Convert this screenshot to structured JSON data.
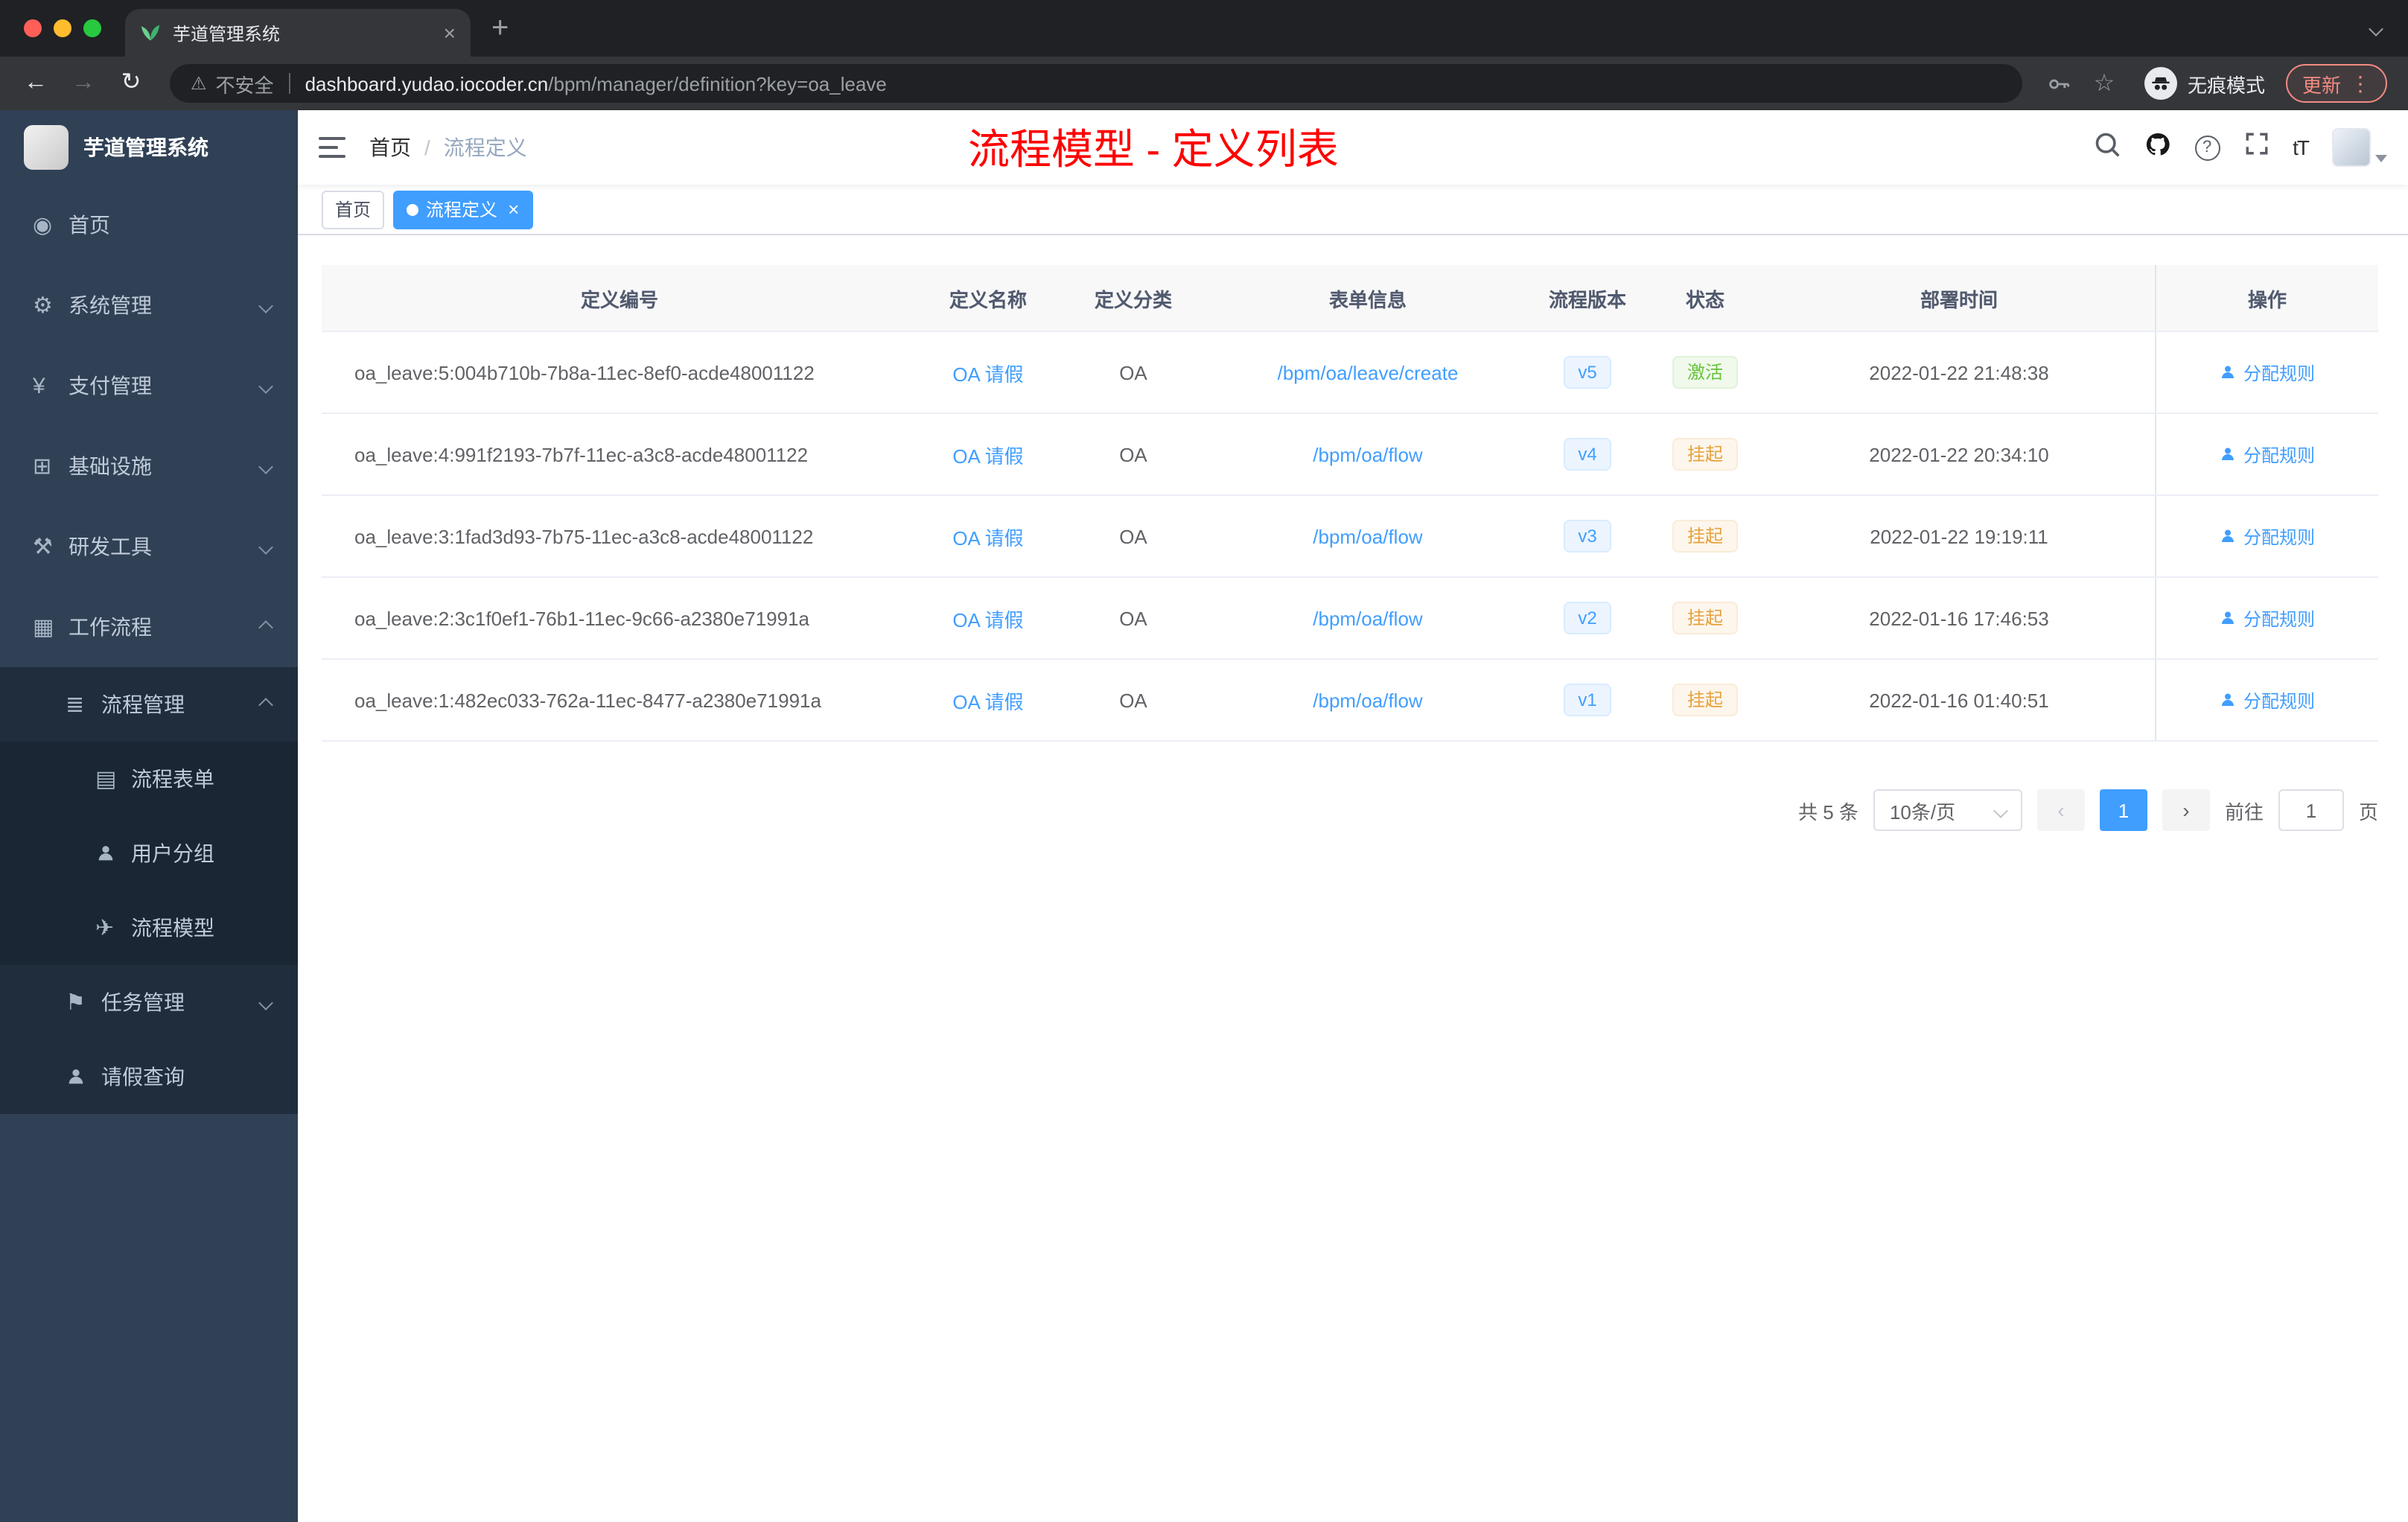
{
  "browser": {
    "tab_title": "芋道管理系统",
    "new_tab_label": "+",
    "security_label": "不安全",
    "url_host": "dashboard.yudao.iocoder.cn",
    "url_path": "/bpm/manager/definition?key=oa_leave",
    "incognito_label": "无痕模式",
    "update_label": "更新"
  },
  "sidebar": {
    "app_title": "芋道管理系统",
    "items": [
      {
        "key": "home",
        "label": "首页",
        "icon": "◉",
        "level": 0,
        "chevron": null
      },
      {
        "key": "system",
        "label": "系统管理",
        "icon": "⚙",
        "level": 0,
        "chevron": "down"
      },
      {
        "key": "payment",
        "label": "支付管理",
        "icon": "¥",
        "level": 0,
        "chevron": "down"
      },
      {
        "key": "infrastructure",
        "label": "基础设施",
        "icon": "⊞",
        "level": 0,
        "chevron": "down"
      },
      {
        "key": "dev-tools",
        "label": "研发工具",
        "icon": "⚒",
        "level": 0,
        "chevron": "down"
      },
      {
        "key": "workflow",
        "label": "工作流程",
        "icon": "▦",
        "level": 0,
        "chevron": "up"
      },
      {
        "key": "process-management",
        "label": "流程管理",
        "icon": "≣",
        "level": 1,
        "chevron": "up"
      },
      {
        "key": "process-form",
        "label": "流程表单",
        "icon": "▤",
        "level": 2,
        "chevron": null
      },
      {
        "key": "user-group",
        "label": "用户分组",
        "icon": "person",
        "level": 2,
        "chevron": null
      },
      {
        "key": "process-model",
        "label": "流程模型",
        "icon": "✈",
        "level": 2,
        "chevron": null
      },
      {
        "key": "task-management",
        "label": "任务管理",
        "icon": "⚑",
        "level": 1,
        "chevron": "down"
      },
      {
        "key": "leave-query",
        "label": "请假查询",
        "icon": "person",
        "level": 1,
        "chevron": null
      }
    ]
  },
  "navbar": {
    "breadcrumb_home": "首页",
    "breadcrumb_separator": "/",
    "breadcrumb_current": "流程定义",
    "annotation": "流程模型 - 定义列表",
    "fontsize_icon_label": "tT"
  },
  "tags": {
    "items": [
      {
        "label": "首页",
        "active": false
      },
      {
        "label": "流程定义",
        "active": true
      }
    ]
  },
  "table": {
    "columns": [
      "定义编号",
      "定义名称",
      "定义分类",
      "表单信息",
      "流程版本",
      "状态",
      "部署时间",
      "操作"
    ],
    "rows": [
      {
        "id": "oa_leave:5:004b710b-7b8a-11ec-8ef0-acde48001122",
        "name": "OA 请假",
        "category": "OA",
        "form": "/bpm/oa/leave/create",
        "version": "v5",
        "status": "激活",
        "status_type": "success",
        "deploy_time": "2022-01-22 21:48:38",
        "action": "分配规则"
      },
      {
        "id": "oa_leave:4:991f2193-7b7f-11ec-a3c8-acde48001122",
        "name": "OA 请假",
        "category": "OA",
        "form": "/bpm/oa/flow",
        "version": "v4",
        "status": "挂起",
        "status_type": "warning",
        "deploy_time": "2022-01-22 20:34:10",
        "action": "分配规则"
      },
      {
        "id": "oa_leave:3:1fad3d93-7b75-11ec-a3c8-acde48001122",
        "name": "OA 请假",
        "category": "OA",
        "form": "/bpm/oa/flow",
        "version": "v3",
        "status": "挂起",
        "status_type": "warning",
        "deploy_time": "2022-01-22 19:19:11",
        "action": "分配规则"
      },
      {
        "id": "oa_leave:2:3c1f0ef1-76b1-11ec-9c66-a2380e71991a",
        "name": "OA 请假",
        "category": "OA",
        "form": "/bpm/oa/flow",
        "version": "v2",
        "status": "挂起",
        "status_type": "warning",
        "deploy_time": "2022-01-16 17:46:53",
        "action": "分配规则"
      },
      {
        "id": "oa_leave:1:482ec033-762a-11ec-8477-a2380e71991a",
        "name": "OA 请假",
        "category": "OA",
        "form": "/bpm/oa/flow",
        "version": "v1",
        "status": "挂起",
        "status_type": "warning",
        "deploy_time": "2022-01-16 01:40:51",
        "action": "分配规则"
      }
    ]
  },
  "pagination": {
    "total": "共 5 条",
    "page_size": "10条/页",
    "prev": "‹",
    "next": "›",
    "current_page": "1",
    "goto_prefix": "前往",
    "goto_value": "1",
    "goto_suffix": "页"
  },
  "colors": {
    "accent_blue": "#409eff",
    "annotation_red": "#ff0000",
    "success_green": "#67c23a",
    "warning_orange": "#e6a23c",
    "sidebar_bg": "#304156",
    "submenu_bg": "#1f2d3d"
  }
}
